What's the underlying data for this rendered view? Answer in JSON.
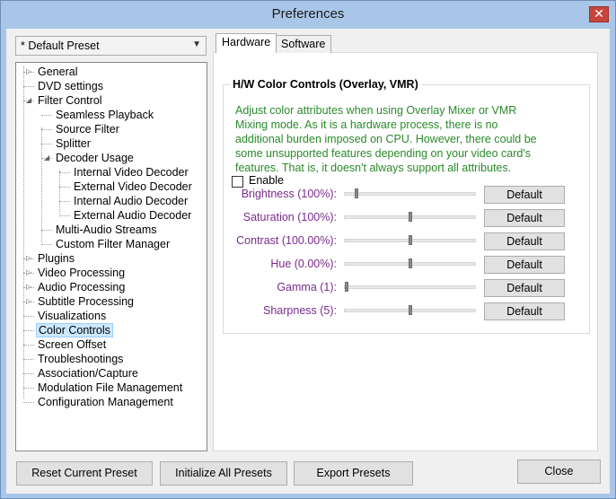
{
  "window": {
    "title": "Preferences",
    "close_glyph": "✕"
  },
  "preset": {
    "selected": "* Default Preset"
  },
  "tree": {
    "items": [
      {
        "label": "General",
        "level": 0,
        "expander": "▷"
      },
      {
        "label": "DVD settings",
        "level": 0,
        "expander": ""
      },
      {
        "label": "Filter Control",
        "level": 0,
        "expander": "◢"
      },
      {
        "label": "Seamless Playback",
        "level": 1,
        "expander": ""
      },
      {
        "label": "Source Filter",
        "level": 1,
        "expander": ""
      },
      {
        "label": "Splitter",
        "level": 1,
        "expander": ""
      },
      {
        "label": "Decoder Usage",
        "level": 1,
        "expander": "◢"
      },
      {
        "label": "Internal Video Decoder",
        "level": 2,
        "expander": ""
      },
      {
        "label": "External Video Decoder",
        "level": 2,
        "expander": ""
      },
      {
        "label": "Internal Audio Decoder",
        "level": 2,
        "expander": ""
      },
      {
        "label": "External Audio Decoder",
        "level": 2,
        "expander": ""
      },
      {
        "label": "Multi-Audio Streams",
        "level": 1,
        "expander": ""
      },
      {
        "label": "Custom Filter Manager",
        "level": 1,
        "expander": ""
      },
      {
        "label": "Plugins",
        "level": 0,
        "expander": "▷"
      },
      {
        "label": "Video Processing",
        "level": 0,
        "expander": "▷"
      },
      {
        "label": "Audio Processing",
        "level": 0,
        "expander": "▷"
      },
      {
        "label": "Subtitle Processing",
        "level": 0,
        "expander": "▷"
      },
      {
        "label": "Visualizations",
        "level": 0,
        "expander": ""
      },
      {
        "label": "Color Controls",
        "level": 0,
        "expander": "",
        "selected": true
      },
      {
        "label": "Screen Offset",
        "level": 0,
        "expander": ""
      },
      {
        "label": "Troubleshootings",
        "level": 0,
        "expander": ""
      },
      {
        "label": "Association/Capture",
        "level": 0,
        "expander": ""
      },
      {
        "label": "Modulation File Management",
        "level": 0,
        "expander": ""
      },
      {
        "label": "Configuration Management",
        "level": 0,
        "expander": ""
      }
    ]
  },
  "tabs": [
    {
      "label": "Hardware",
      "active": true
    },
    {
      "label": "Software",
      "active": false
    }
  ],
  "group": {
    "title": "H/W Color Controls (Overlay, VMR)",
    "description_lines": [
      "Adjust color attributes when using Overlay Mixer or VMR",
      "Mixing mode. As it is a hardware process, there is no",
      "additional burden imposed on CPU. However, there could be",
      "some unsupported features depending on your video card's",
      "features. That is, it doesn't always support all attributes."
    ],
    "enable_label": "Enable",
    "enable_checked": false,
    "controls": [
      {
        "label": "Brightness (100%):",
        "level": 0.08,
        "button": "Default"
      },
      {
        "label": "Saturation (100%):",
        "level": 0.5,
        "button": "Default"
      },
      {
        "label": "Contrast (100.00%):",
        "level": 0.5,
        "button": "Default"
      },
      {
        "label": "Hue (0.00%):",
        "level": 0.5,
        "button": "Default"
      },
      {
        "label": "Gamma (1):",
        "level": 0.0,
        "button": "Default"
      },
      {
        "label": "Sharpness (5):",
        "level": 0.5,
        "button": "Default"
      }
    ]
  },
  "footer": {
    "reset": "Reset Current Preset",
    "initialize": "Initialize All Presets",
    "export": "Export Presets",
    "close": "Close"
  }
}
